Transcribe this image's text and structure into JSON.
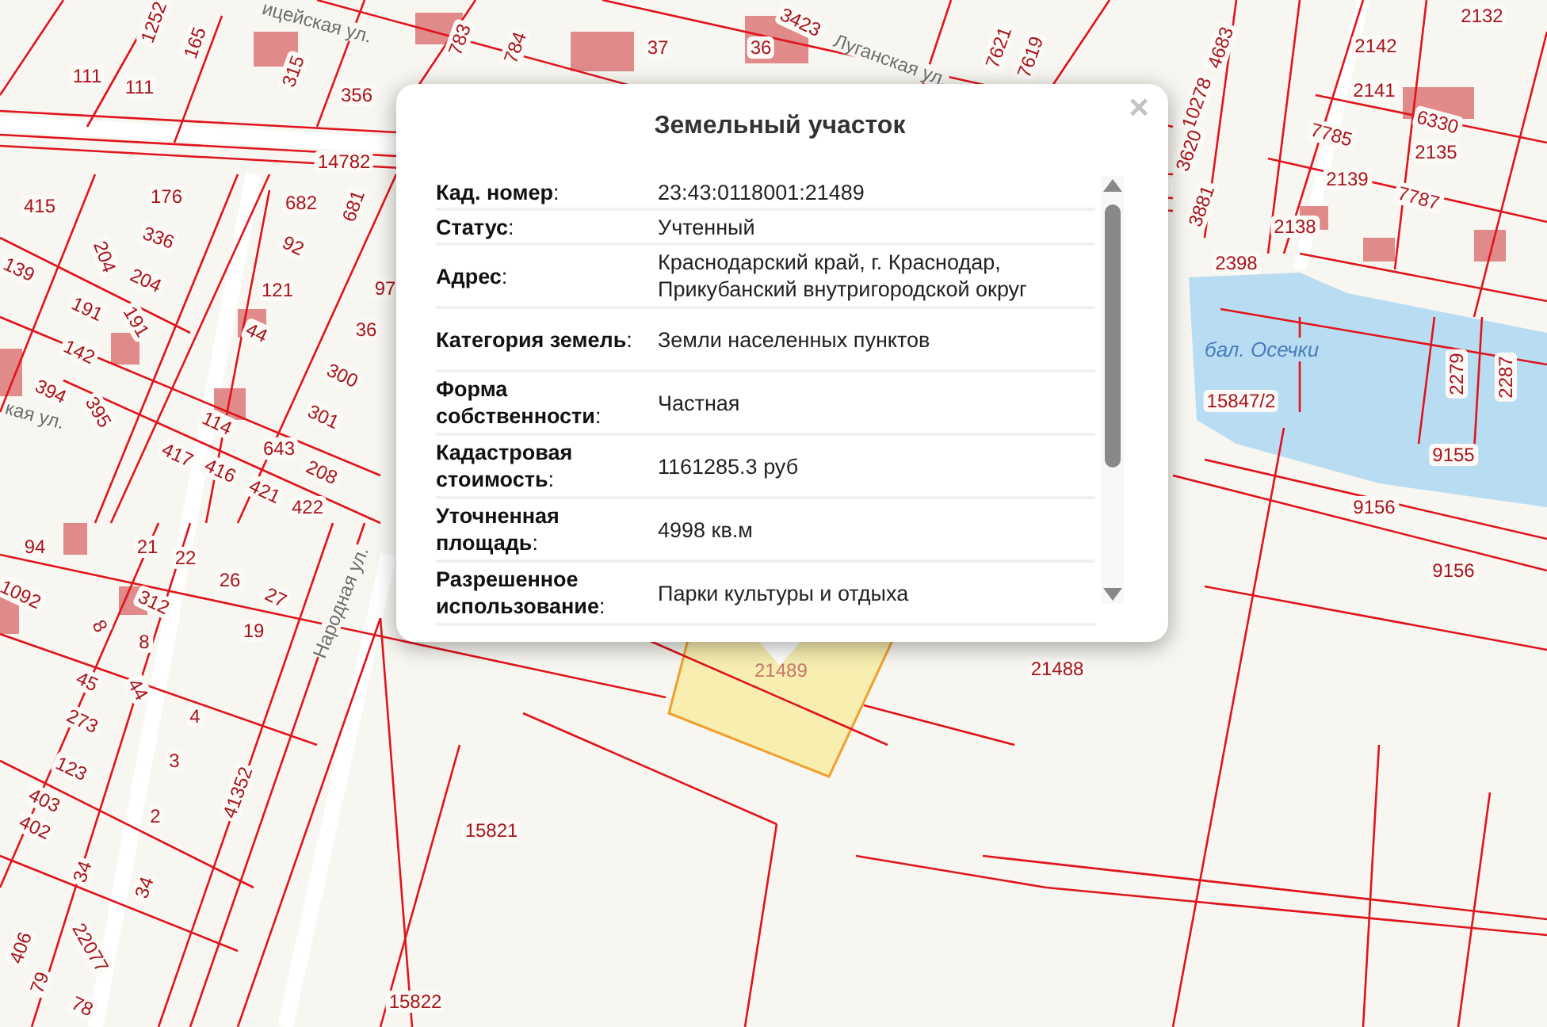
{
  "map": {
    "street_labels": [
      "ицейская ул.",
      "Луганская ул.",
      "кая ул.",
      "Народная ул."
    ],
    "water_label": "бал. Осечки",
    "parcel_labels": [
      "111",
      "111",
      "1252",
      "165",
      "315",
      "356",
      "14782",
      "415",
      "176",
      "336",
      "204",
      "204",
      "139",
      "191",
      "191",
      "142",
      "394",
      "395",
      "682",
      "681",
      "92",
      "121",
      "44",
      "97",
      "36",
      "300",
      "301",
      "114",
      "643",
      "208",
      "417",
      "416",
      "421",
      "422",
      "94",
      "1092",
      "21",
      "22",
      "26",
      "27",
      "312",
      "19",
      "8",
      "8",
      "45",
      "44",
      "273",
      "4",
      "3",
      "123",
      "41352",
      "403",
      "2",
      "402",
      "34",
      "34",
      "22077",
      "406",
      "79",
      "78",
      "15821",
      "15822",
      "21488",
      "783",
      "784",
      "37",
      "36",
      "3423",
      "7621",
      "7619",
      "4683",
      "10278",
      "3620",
      "3881",
      "2132",
      "2142",
      "2141",
      "6330",
      "7785",
      "2135",
      "2139",
      "7787",
      "2138",
      "2398",
      "2279",
      "2287",
      "15847/2",
      "9155",
      "9156",
      "9156"
    ],
    "selected_parcel": "21489"
  },
  "popup": {
    "title": "Земельный участок",
    "close": "×",
    "rows": [
      {
        "label": "**Кад. номер**:",
        "value": "23:43:0118001:21489"
      },
      {
        "label": "**Статус**:",
        "value": "Учтенный"
      },
      {
        "label": "**Адрес**:",
        "value": "Краснодарский край, г. Краснодар, Прикубанский внутригородской округ"
      },
      {
        "label": "**Категория земель**:",
        "value": "Земли населенных пунктов"
      },
      {
        "label": "**Форма собственности**:",
        "value": "Частная"
      },
      {
        "label": "**Кадастровая стоимость**:",
        "value": "1161285.3 руб"
      },
      {
        "label": "**Уточненная площадь**:",
        "value": "4998 кв.м"
      },
      {
        "label": "**Разрешенное использование**:",
        "value": "Парки культуры и отдыха"
      }
    ]
  }
}
